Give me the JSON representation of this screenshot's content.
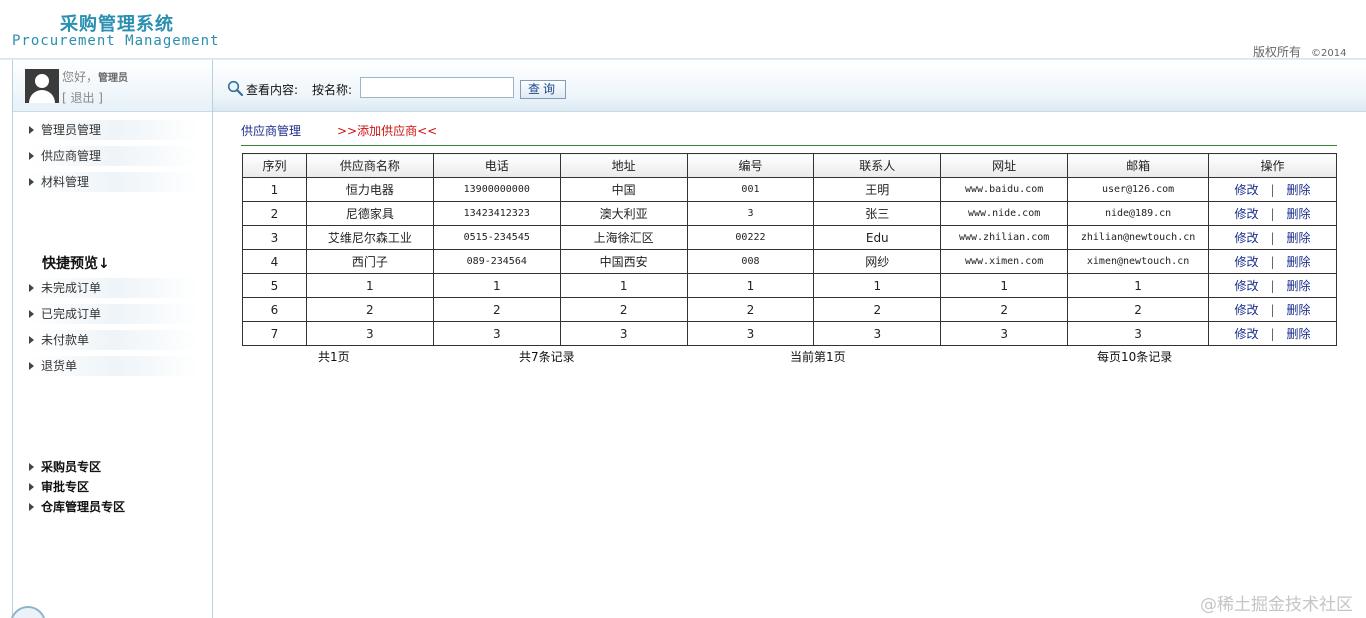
{
  "app": {
    "title_cn": "采购管理系统",
    "title_en": "Procurement Management",
    "copyright": "版权所有",
    "copyright_year": "©2014"
  },
  "user": {
    "greeting": "您好，",
    "name": "管理员",
    "logout": "[ 退出 ]"
  },
  "sidebar": {
    "items": [
      {
        "label": "管理员管理"
      },
      {
        "label": "供应商管理"
      },
      {
        "label": "材料管理"
      }
    ],
    "quick_title": "快捷预览↓",
    "quick_items": [
      {
        "label": "未完成订单"
      },
      {
        "label": "已完成订单"
      },
      {
        "label": "未付款单"
      },
      {
        "label": "退货单"
      }
    ],
    "zones": [
      {
        "label": "采购员专区"
      },
      {
        "label": "审批专区"
      },
      {
        "label": "仓库管理员专区"
      }
    ]
  },
  "search": {
    "view_label": "查看内容:",
    "name_label": "按名称:",
    "value": "",
    "button_label": "查询"
  },
  "breadcrumb": {
    "current": "供应商管理",
    "add_link": ">>添加供应商<<"
  },
  "table": {
    "headers": [
      "序列",
      "供应商名称",
      "电话",
      "地址",
      "编号",
      "联系人",
      "网址",
      "邮箱",
      "操作"
    ],
    "edit_label": "修改",
    "separator": "|",
    "delete_label": "删除",
    "rows": [
      [
        "1",
        "恒力电器",
        "13900000000",
        "中国",
        "001",
        "王明",
        "www.baidu.com",
        "user@126.com"
      ],
      [
        "2",
        "尼德家具",
        "13423412323",
        "澳大利亚",
        "3",
        "张三",
        "www.nide.com",
        "nide@189.cn"
      ],
      [
        "3",
        "艾维尼尔森工业",
        "0515-234545",
        "上海徐汇区",
        "00222",
        "Edu",
        "www.zhilian.com",
        "zhilian@newtouch.cn"
      ],
      [
        "4",
        "西门子",
        "089-234564",
        "中国西安",
        "008",
        "网纱",
        "www.ximen.com",
        "ximen@newtouch.cn"
      ],
      [
        "5",
        "1",
        "1",
        "1",
        "1",
        "1",
        "1",
        "1"
      ],
      [
        "6",
        "2",
        "2",
        "2",
        "2",
        "2",
        "2",
        "2"
      ],
      [
        "7",
        "3",
        "3",
        "3",
        "3",
        "3",
        "3",
        "3"
      ]
    ]
  },
  "pager": {
    "total_pages": "共1页",
    "total_records": "共7条记录",
    "current_page": "当前第1页",
    "per_page": "每页10条记录"
  },
  "watermark": "@稀土掘金技术社区"
}
